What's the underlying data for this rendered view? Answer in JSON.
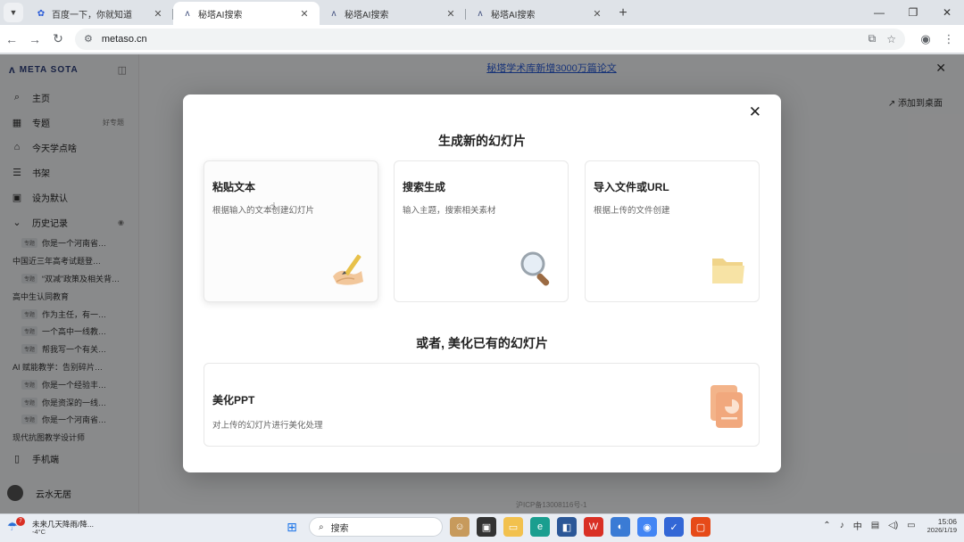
{
  "browser": {
    "tabs": [
      {
        "title": "百度一下，你就知道",
        "favicon": "baidu-paw-icon",
        "active": false
      },
      {
        "title": "秘塔AI搜索",
        "favicon": "metaso-icon",
        "active": true
      },
      {
        "title": "秘塔AI搜索",
        "favicon": "metaso-icon",
        "active": false
      },
      {
        "title": "秘塔AI搜索",
        "favicon": "metaso-icon",
        "active": false
      }
    ],
    "url": "metaso.cn"
  },
  "sidebar": {
    "logo": "META SOTA",
    "nav": [
      {
        "label": "主页",
        "icon": "search-icon"
      },
      {
        "label": "专题",
        "icon": "grid-icon",
        "extra": "好专题"
      },
      {
        "label": "今天学点啥",
        "icon": "graduation-cap-icon"
      },
      {
        "label": "书架",
        "icon": "bookshelf-icon"
      },
      {
        "label": "设为默认",
        "icon": "calendar-icon"
      },
      {
        "label": "历史记录",
        "icon": "chevron-down-icon"
      }
    ],
    "history": [
      {
        "tag": "专题",
        "text": "你是一个河南省…"
      },
      {
        "tag": "",
        "text": "中国近三年高考试题登…"
      },
      {
        "tag": "专题",
        "text": "“双减”政策及相关背…"
      },
      {
        "tag": "",
        "text": "高中生认同教育"
      },
      {
        "tag": "专题",
        "text": "作为主任，有一…"
      },
      {
        "tag": "专题",
        "text": "一个高中一线教…"
      },
      {
        "tag": "专题",
        "text": "帮我写一个有关…"
      },
      {
        "tag": "",
        "text": "AI 赋能教学：告别碎片…"
      },
      {
        "tag": "专题",
        "text": "你是一个经验丰…"
      },
      {
        "tag": "专题",
        "text": "你是资深的一线…"
      },
      {
        "tag": "专题",
        "text": "你是一个河南省…"
      },
      {
        "tag": "",
        "text": "现代抗图教学设计师"
      }
    ],
    "mobile": "手机端",
    "user": "云水无居"
  },
  "page": {
    "banner": "秘塔学术库新增3000万篇论文",
    "add_to_desktop": "添加到桌面",
    "footnote": "沪ICP备13008116号-1"
  },
  "modal": {
    "title": "生成新的幻灯片",
    "cards": [
      {
        "title": "粘贴文本",
        "desc": "根据输入的文本创建幻灯片",
        "icon": "pen-writing-icon"
      },
      {
        "title": "搜索生成",
        "desc": "输入主题，搜索相关素材",
        "icon": "magnifier-icon"
      },
      {
        "title": "导入文件或URL",
        "desc": "根据上传的文件创建",
        "icon": "folder-icon"
      }
    ],
    "or_title": "或者, 美化已有的幻灯片",
    "beautify": {
      "title": "美化PPT",
      "desc": "对上传的幻灯片进行美化处理",
      "icon": "ppt-file-icon"
    }
  },
  "taskbar": {
    "weather_badge": "7",
    "weather_line1": "未来几天降雨/降...",
    "weather_line2": "-4°C",
    "search": "搜索",
    "time": "15:06",
    "date": "2026/1/19"
  }
}
